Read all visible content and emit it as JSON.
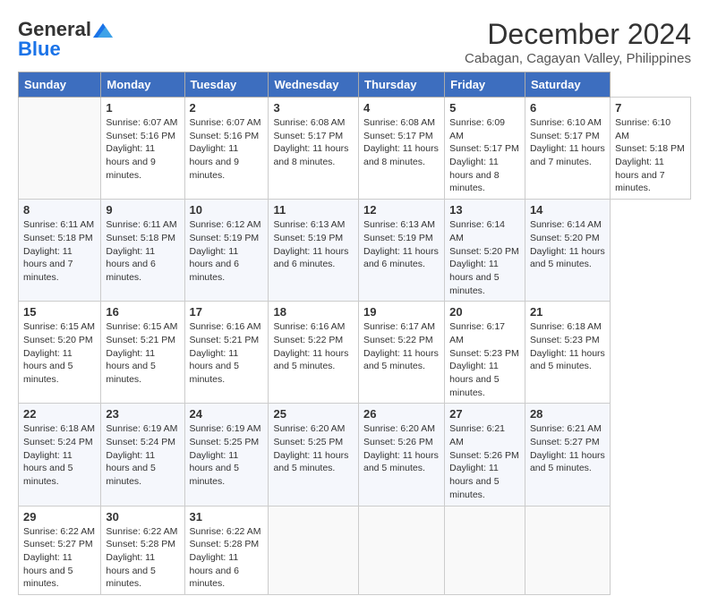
{
  "header": {
    "logo_line1": "General",
    "logo_line2": "Blue",
    "title": "December 2024",
    "subtitle": "Cabagan, Cagayan Valley, Philippines"
  },
  "calendar": {
    "days_of_week": [
      "Sunday",
      "Monday",
      "Tuesday",
      "Wednesday",
      "Thursday",
      "Friday",
      "Saturday"
    ],
    "weeks": [
      [
        null,
        {
          "day": "1",
          "sunrise": "6:07 AM",
          "sunset": "5:16 PM",
          "daylight": "11 hours and 9 minutes."
        },
        {
          "day": "2",
          "sunrise": "6:07 AM",
          "sunset": "5:16 PM",
          "daylight": "11 hours and 9 minutes."
        },
        {
          "day": "3",
          "sunrise": "6:08 AM",
          "sunset": "5:17 PM",
          "daylight": "11 hours and 8 minutes."
        },
        {
          "day": "4",
          "sunrise": "6:08 AM",
          "sunset": "5:17 PM",
          "daylight": "11 hours and 8 minutes."
        },
        {
          "day": "5",
          "sunrise": "6:09 AM",
          "sunset": "5:17 PM",
          "daylight": "11 hours and 8 minutes."
        },
        {
          "day": "6",
          "sunrise": "6:10 AM",
          "sunset": "5:17 PM",
          "daylight": "11 hours and 7 minutes."
        },
        {
          "day": "7",
          "sunrise": "6:10 AM",
          "sunset": "5:18 PM",
          "daylight": "11 hours and 7 minutes."
        }
      ],
      [
        {
          "day": "8",
          "sunrise": "6:11 AM",
          "sunset": "5:18 PM",
          "daylight": "11 hours and 7 minutes."
        },
        {
          "day": "9",
          "sunrise": "6:11 AM",
          "sunset": "5:18 PM",
          "daylight": "11 hours and 6 minutes."
        },
        {
          "day": "10",
          "sunrise": "6:12 AM",
          "sunset": "5:19 PM",
          "daylight": "11 hours and 6 minutes."
        },
        {
          "day": "11",
          "sunrise": "6:13 AM",
          "sunset": "5:19 PM",
          "daylight": "11 hours and 6 minutes."
        },
        {
          "day": "12",
          "sunrise": "6:13 AM",
          "sunset": "5:19 PM",
          "daylight": "11 hours and 6 minutes."
        },
        {
          "day": "13",
          "sunrise": "6:14 AM",
          "sunset": "5:20 PM",
          "daylight": "11 hours and 5 minutes."
        },
        {
          "day": "14",
          "sunrise": "6:14 AM",
          "sunset": "5:20 PM",
          "daylight": "11 hours and 5 minutes."
        }
      ],
      [
        {
          "day": "15",
          "sunrise": "6:15 AM",
          "sunset": "5:20 PM",
          "daylight": "11 hours and 5 minutes."
        },
        {
          "day": "16",
          "sunrise": "6:15 AM",
          "sunset": "5:21 PM",
          "daylight": "11 hours and 5 minutes."
        },
        {
          "day": "17",
          "sunrise": "6:16 AM",
          "sunset": "5:21 PM",
          "daylight": "11 hours and 5 minutes."
        },
        {
          "day": "18",
          "sunrise": "6:16 AM",
          "sunset": "5:22 PM",
          "daylight": "11 hours and 5 minutes."
        },
        {
          "day": "19",
          "sunrise": "6:17 AM",
          "sunset": "5:22 PM",
          "daylight": "11 hours and 5 minutes."
        },
        {
          "day": "20",
          "sunrise": "6:17 AM",
          "sunset": "5:23 PM",
          "daylight": "11 hours and 5 minutes."
        },
        {
          "day": "21",
          "sunrise": "6:18 AM",
          "sunset": "5:23 PM",
          "daylight": "11 hours and 5 minutes."
        }
      ],
      [
        {
          "day": "22",
          "sunrise": "6:18 AM",
          "sunset": "5:24 PM",
          "daylight": "11 hours and 5 minutes."
        },
        {
          "day": "23",
          "sunrise": "6:19 AM",
          "sunset": "5:24 PM",
          "daylight": "11 hours and 5 minutes."
        },
        {
          "day": "24",
          "sunrise": "6:19 AM",
          "sunset": "5:25 PM",
          "daylight": "11 hours and 5 minutes."
        },
        {
          "day": "25",
          "sunrise": "6:20 AM",
          "sunset": "5:25 PM",
          "daylight": "11 hours and 5 minutes."
        },
        {
          "day": "26",
          "sunrise": "6:20 AM",
          "sunset": "5:26 PM",
          "daylight": "11 hours and 5 minutes."
        },
        {
          "day": "27",
          "sunrise": "6:21 AM",
          "sunset": "5:26 PM",
          "daylight": "11 hours and 5 minutes."
        },
        {
          "day": "28",
          "sunrise": "6:21 AM",
          "sunset": "5:27 PM",
          "daylight": "11 hours and 5 minutes."
        }
      ],
      [
        {
          "day": "29",
          "sunrise": "6:22 AM",
          "sunset": "5:27 PM",
          "daylight": "11 hours and 5 minutes."
        },
        {
          "day": "30",
          "sunrise": "6:22 AM",
          "sunset": "5:28 PM",
          "daylight": "11 hours and 5 minutes."
        },
        {
          "day": "31",
          "sunrise": "6:22 AM",
          "sunset": "5:28 PM",
          "daylight": "11 hours and 6 minutes."
        },
        null,
        null,
        null,
        null
      ]
    ]
  }
}
